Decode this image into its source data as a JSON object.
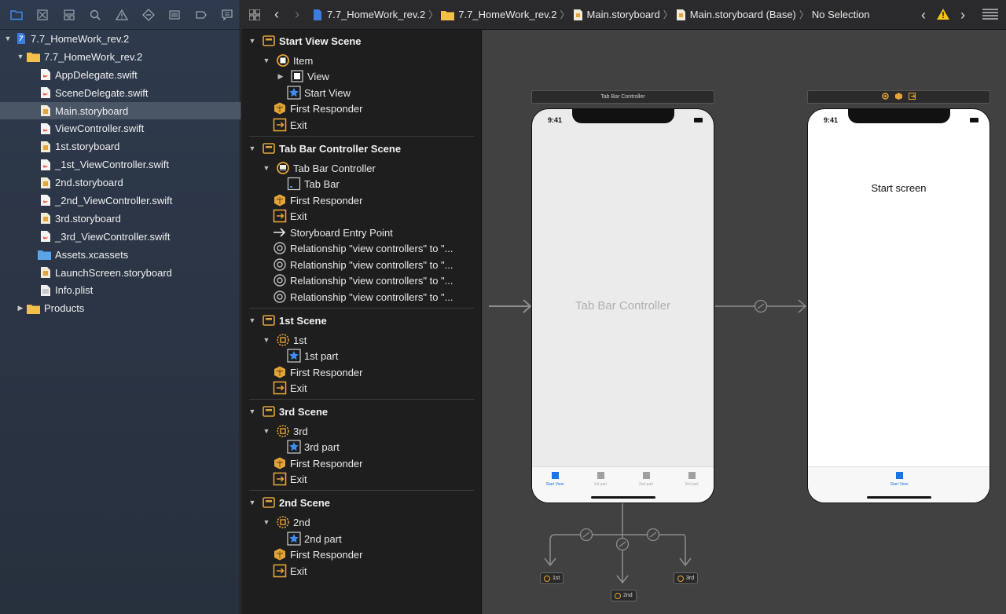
{
  "jumpbar": {
    "crumbs": [
      "7.7_HomeWork_rev.2",
      "7.7_HomeWork_rev.2",
      "Main.storyboard",
      "Main.storyboard (Base)",
      "No Selection"
    ]
  },
  "navigator": {
    "project": "7.7_HomeWork_rev.2",
    "group": "7.7_HomeWork_rev.2",
    "files": [
      "AppDelegate.swift",
      "SceneDelegate.swift",
      "Main.storyboard",
      "ViewController.swift",
      "1st.storyboard",
      "_1st_ViewController.swift",
      "2nd.storyboard",
      "_2nd_ViewController.swift",
      "3rd.storyboard",
      "_3rd_ViewController.swift",
      "Assets.xcassets",
      "LaunchScreen.storyboard",
      "Info.plist"
    ],
    "products": "Products"
  },
  "outline": {
    "start_scene": {
      "title": "Start View Scene",
      "item": "Item",
      "view": "View",
      "start_view": "Start View",
      "first_responder": "First Responder",
      "exit": "Exit"
    },
    "tabbar_scene": {
      "title": "Tab Bar Controller Scene",
      "controller": "Tab Bar Controller",
      "tab_bar": "Tab Bar",
      "first_responder": "First Responder",
      "exit": "Exit",
      "entry_point": "Storyboard Entry Point",
      "relationship": "Relationship \"view controllers\" to \"..."
    },
    "first_scene": {
      "title": "1st Scene",
      "ref": "1st",
      "item": "1st part",
      "first_responder": "First Responder",
      "exit": "Exit"
    },
    "third_scene": {
      "title": "3rd Scene",
      "ref": "3rd",
      "item": "3rd part",
      "first_responder": "First Responder",
      "exit": "Exit"
    },
    "second_scene": {
      "title": "2nd Scene",
      "ref": "2nd",
      "item": "2nd part",
      "first_responder": "First Responder",
      "exit": "Exit"
    }
  },
  "canvas": {
    "tabbar_scene_title": "Tab Bar Controller",
    "status_time": "9:41",
    "tabbar_center_label": "Tab Bar Controller",
    "tabs": [
      "Start View",
      "1st part",
      "2nd part",
      "3rd part"
    ],
    "start_screen_label": "Start screen",
    "start_tab": "Start View",
    "refs": [
      "1st",
      "2nd",
      "3rd"
    ]
  },
  "colors": {
    "accent": "#1a74e8",
    "storyboard_orange": "#e3a43a",
    "selection": "#4a5566"
  }
}
